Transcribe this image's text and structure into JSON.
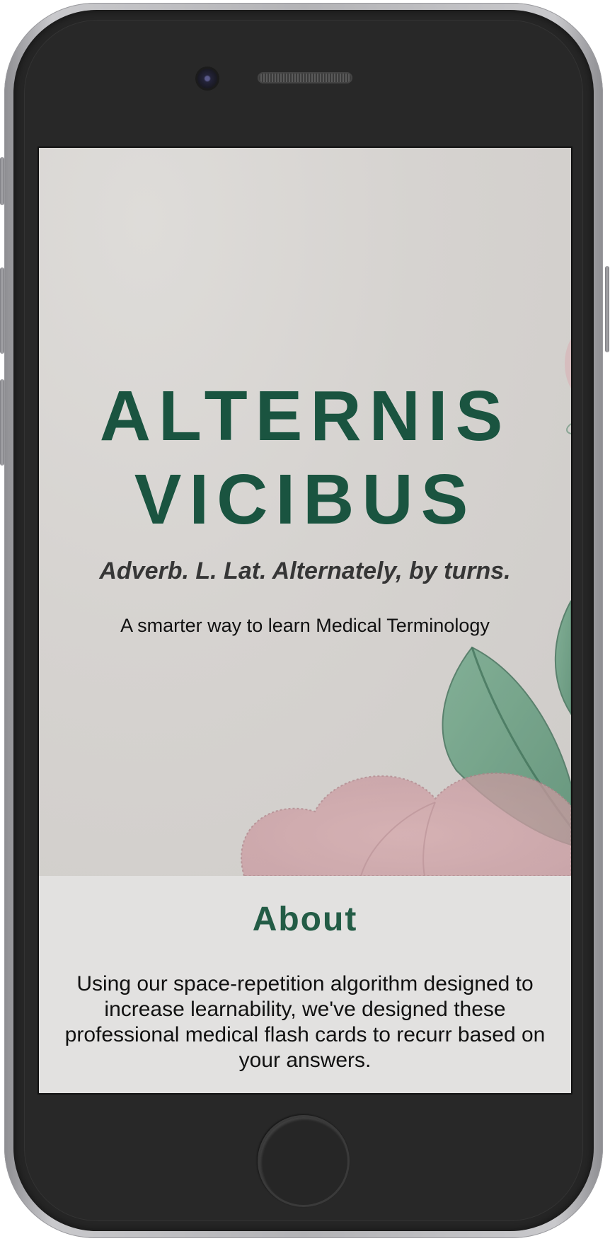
{
  "hero": {
    "title_line1": "ALTERNIS",
    "title_line2": "VICIBUS",
    "subtitle": "Adverb. L. Lat. Alternately, by turns.",
    "tagline": "A smarter way to learn Medical Terminology"
  },
  "about": {
    "heading": "About",
    "body": "Using our space-repetition algorithm designed to increase learnability, we've designed these professional medical flash cards to recurr based on your answers."
  },
  "colors": {
    "brand_green": "#1a5440",
    "about_heading": "#235c46",
    "phone_body": "#262626",
    "screen_bg": "#e2e1e0"
  },
  "icons": {
    "hero_illustration": "rose-flower-watercolor"
  }
}
